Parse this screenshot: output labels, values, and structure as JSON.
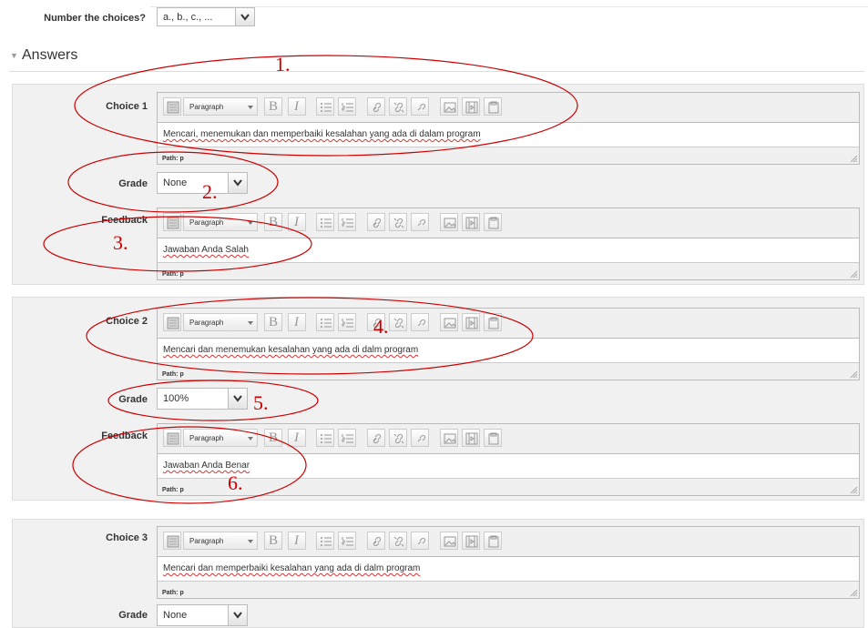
{
  "number_choices": {
    "label": "Number the choices?",
    "value": "a., b., c., ..."
  },
  "answers_header": "Answers",
  "toolbar": {
    "paragraph_label": "Paragraph",
    "bold": "B",
    "italic": "I",
    "path_label": "Path: p"
  },
  "choices": [
    {
      "label": "Choice 1",
      "text": "Mencari, menemukan dan memperbaiki kesalahan yang ada di dalam program",
      "grade_label": "Grade",
      "grade": "None",
      "feedback_label": "Feedback",
      "feedback": "Jawaban Anda Salah"
    },
    {
      "label": "Choice 2",
      "text": "Mencari dan menemukan kesalahan yang ada di dalm program",
      "grade_label": "Grade",
      "grade": "100%",
      "feedback_label": "Feedback",
      "feedback": "Jawaban Anda Benar"
    },
    {
      "label": "Choice 3",
      "text": "Mencari dan memperbaiki kesalahan yang ada di dalm program",
      "grade_label": "Grade",
      "grade": "None"
    }
  ],
  "annotations": [
    "1.",
    "2.",
    "3.",
    "4.",
    "5.",
    "6."
  ],
  "colors": {
    "annotation": "#cc0000",
    "panel": "#f1f1f1",
    "squiggle": "#dd3333"
  }
}
